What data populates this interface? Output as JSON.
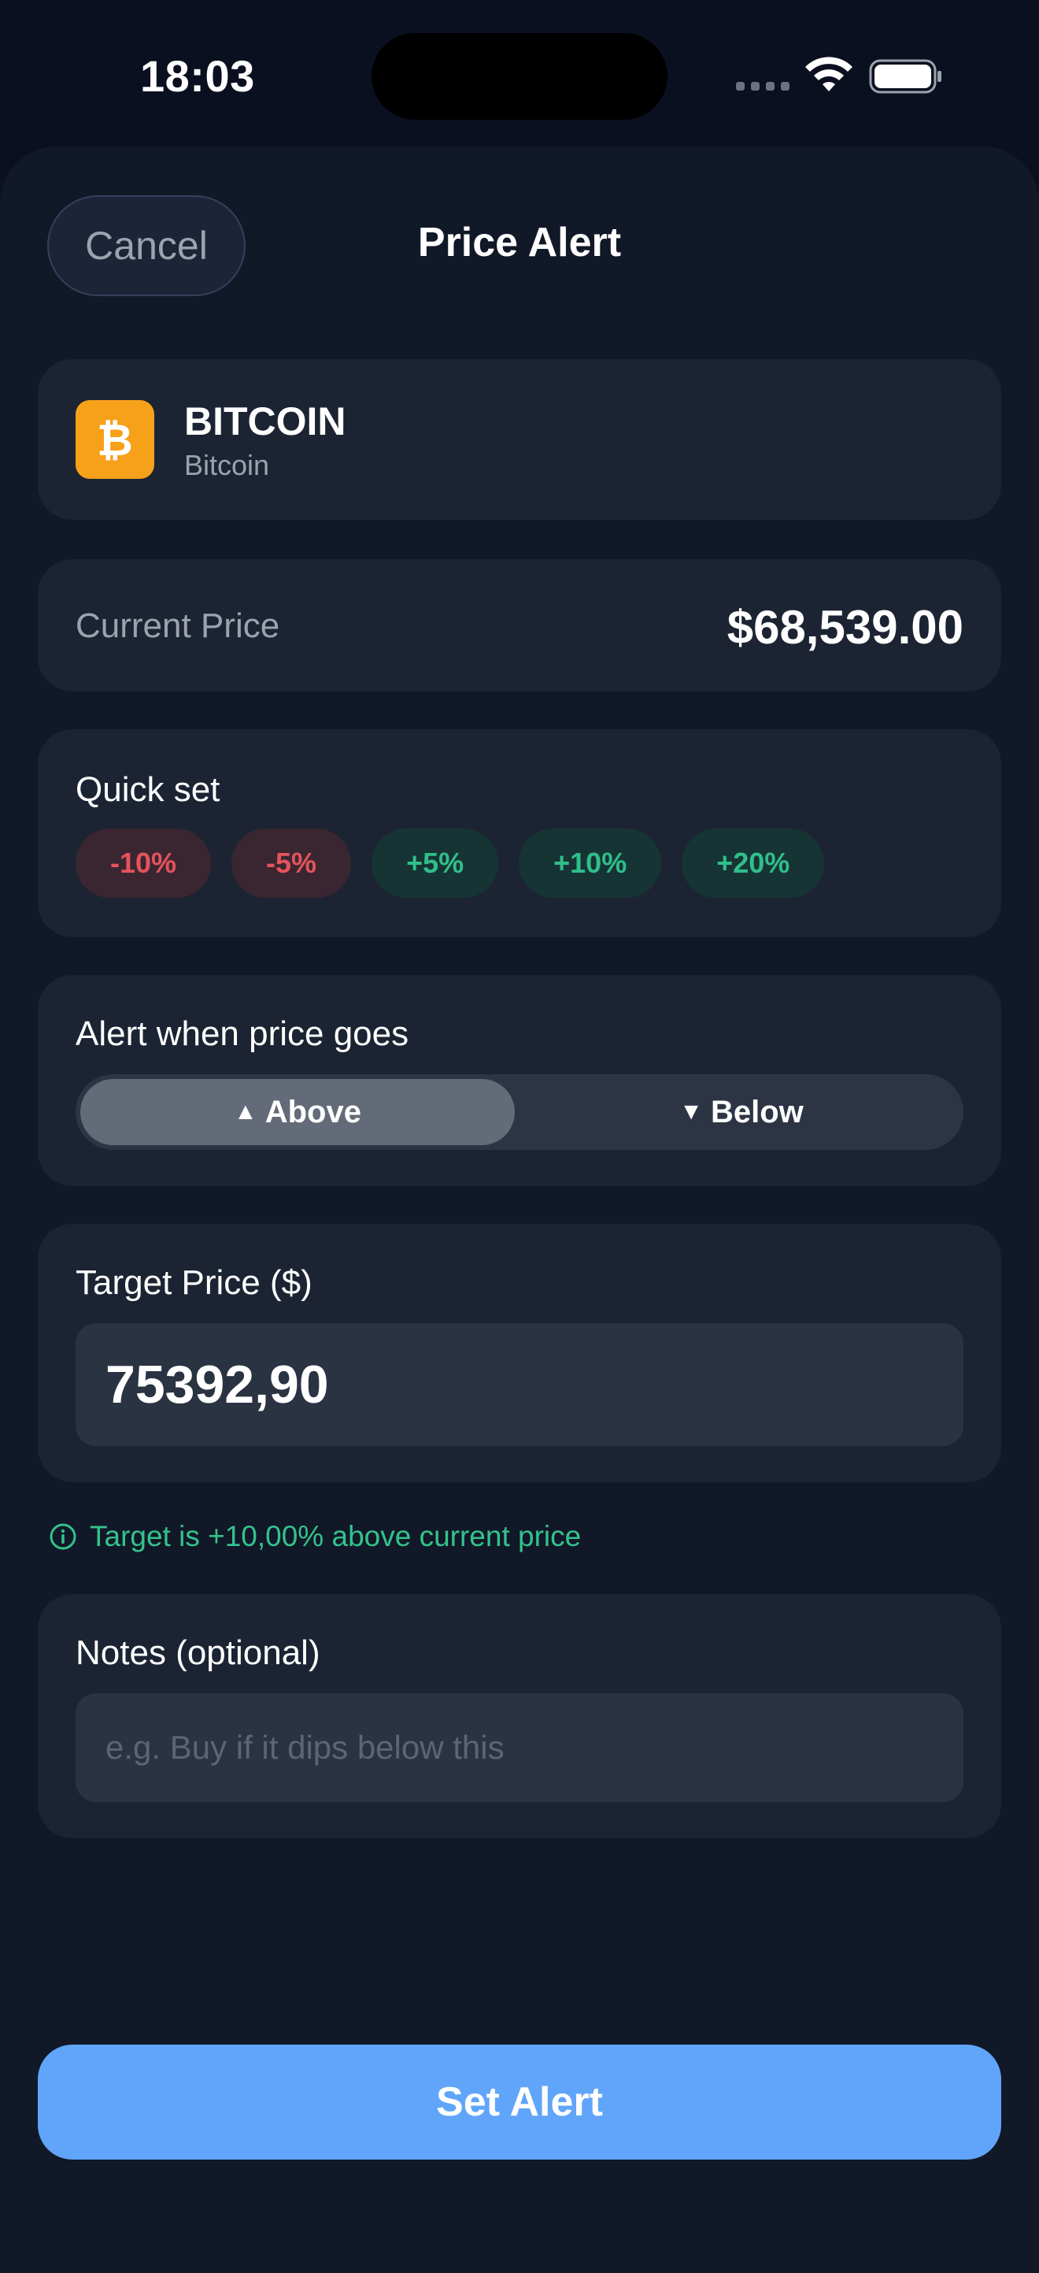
{
  "status": {
    "time": "18:03"
  },
  "header": {
    "cancel_label": "Cancel",
    "title": "Price Alert"
  },
  "coin": {
    "symbol": "BITCOIN",
    "name": "Bitcoin",
    "logo_glyph": "₿",
    "logo_color": "#f7a01a"
  },
  "current_price": {
    "label": "Current Price",
    "value": "$68,539.00"
  },
  "quick_set": {
    "label": "Quick set",
    "chips": [
      {
        "label": "-10%",
        "tone": "negative"
      },
      {
        "label": "-5%",
        "tone": "negative"
      },
      {
        "label": "+5%",
        "tone": "positive"
      },
      {
        "label": "+10%",
        "tone": "positive"
      },
      {
        "label": "+20%",
        "tone": "positive"
      }
    ]
  },
  "direction": {
    "label": "Alert when price goes",
    "options": [
      {
        "label": "Above",
        "icon": "triangle-up-icon",
        "glyph": "▲",
        "selected": true
      },
      {
        "label": "Below",
        "icon": "triangle-down-icon",
        "glyph": "▼",
        "selected": false
      }
    ]
  },
  "target": {
    "label": "Target Price ($)",
    "value": "75392,90"
  },
  "hint": {
    "text": "Target is +10,00% above current price",
    "icon": "info-icon",
    "color": "#34c28c"
  },
  "notes": {
    "label": "Notes (optional)",
    "placeholder": "e.g. Buy if it dips below this"
  },
  "submit": {
    "label": "Set Alert",
    "color": "#60a5fa"
  }
}
